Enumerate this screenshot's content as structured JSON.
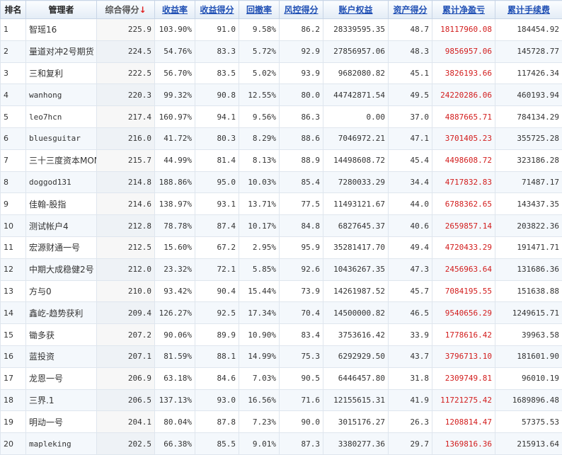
{
  "table": {
    "headers": {
      "rank": "排名",
      "manager": "管理者",
      "composite_score": "综合得分",
      "return_rate": "收益率",
      "return_score": "收益得分",
      "drawdown": "回撤率",
      "risk_score": "风控得分",
      "equity": "账户权益",
      "asset_score": "资产得分",
      "cum_pnl": "累计净盈亏",
      "cum_fee": "累计手续费",
      "sort_arrow": "↓"
    },
    "rows": [
      {
        "rank": "1",
        "manager": "智瑶16",
        "composite": "225.9",
        "return_rate": "103.90%",
        "return_score": "91.0",
        "drawdown": "9.58%",
        "risk_score": "86.2",
        "equity": "28339595.35",
        "asset_score": "48.7",
        "cum_pnl": "18117960.08",
        "cum_fee": "184454.92"
      },
      {
        "rank": "2",
        "manager": "量道对冲2号期货",
        "composite": "224.5",
        "return_rate": "54.76%",
        "return_score": "83.3",
        "drawdown": "5.72%",
        "risk_score": "92.9",
        "equity": "27856957.06",
        "asset_score": "48.3",
        "cum_pnl": "9856957.06",
        "cum_fee": "145728.77"
      },
      {
        "rank": "3",
        "manager": "三和复利",
        "composite": "222.5",
        "return_rate": "56.70%",
        "return_score": "83.5",
        "drawdown": "5.02%",
        "risk_score": "93.9",
        "equity": "9682080.82",
        "asset_score": "45.1",
        "cum_pnl": "3826193.66",
        "cum_fee": "117426.34"
      },
      {
        "rank": "4",
        "manager": "wanhong",
        "composite": "220.3",
        "return_rate": "99.32%",
        "return_score": "90.8",
        "drawdown": "12.55%",
        "risk_score": "80.0",
        "equity": "44742871.54",
        "asset_score": "49.5",
        "cum_pnl": "24220286.06",
        "cum_fee": "460193.94"
      },
      {
        "rank": "5",
        "manager": "leo7hcn",
        "composite": "217.4",
        "return_rate": "160.97%",
        "return_score": "94.1",
        "drawdown": "9.56%",
        "risk_score": "86.3",
        "equity": "0.00",
        "asset_score": "37.0",
        "cum_pnl": "4887665.71",
        "cum_fee": "784134.29"
      },
      {
        "rank": "6",
        "manager": "bluesguitar",
        "composite": "216.0",
        "return_rate": "41.72%",
        "return_score": "80.3",
        "drawdown": "8.29%",
        "risk_score": "88.6",
        "equity": "7046972.21",
        "asset_score": "47.1",
        "cum_pnl": "3701405.23",
        "cum_fee": "355725.28"
      },
      {
        "rank": "7",
        "manager": "三十三度资本MOM",
        "composite": "215.7",
        "return_rate": "44.99%",
        "return_score": "81.4",
        "drawdown": "8.13%",
        "risk_score": "88.9",
        "equity": "14498608.72",
        "asset_score": "45.4",
        "cum_pnl": "4498608.72",
        "cum_fee": "323186.28"
      },
      {
        "rank": "8",
        "manager": "doggod131",
        "composite": "214.8",
        "return_rate": "188.86%",
        "return_score": "95.0",
        "drawdown": "10.03%",
        "risk_score": "85.4",
        "equity": "7280033.29",
        "asset_score": "34.4",
        "cum_pnl": "4717832.83",
        "cum_fee": "71487.17"
      },
      {
        "rank": "9",
        "manager": "佳翰-股指",
        "composite": "214.6",
        "return_rate": "138.97%",
        "return_score": "93.1",
        "drawdown": "13.71%",
        "risk_score": "77.5",
        "equity": "11493121.67",
        "asset_score": "44.0",
        "cum_pnl": "6788362.65",
        "cum_fee": "143437.35"
      },
      {
        "rank": "10",
        "manager": "测试帐户4",
        "composite": "212.8",
        "return_rate": "78.78%",
        "return_score": "87.4",
        "drawdown": "10.17%",
        "risk_score": "84.8",
        "equity": "6827645.37",
        "asset_score": "40.6",
        "cum_pnl": "2659857.14",
        "cum_fee": "203822.36"
      },
      {
        "rank": "11",
        "manager": "宏源财通一号",
        "composite": "212.5",
        "return_rate": "15.60%",
        "return_score": "67.2",
        "drawdown": "2.95%",
        "risk_score": "95.9",
        "equity": "35281417.70",
        "asset_score": "49.4",
        "cum_pnl": "4720433.29",
        "cum_fee": "191471.71"
      },
      {
        "rank": "12",
        "manager": "中期大成稳健2号",
        "composite": "212.0",
        "return_rate": "23.32%",
        "return_score": "72.1",
        "drawdown": "5.85%",
        "risk_score": "92.6",
        "equity": "10436267.35",
        "asset_score": "47.3",
        "cum_pnl": "2456963.64",
        "cum_fee": "131686.36"
      },
      {
        "rank": "13",
        "manager": "方与0",
        "composite": "210.0",
        "return_rate": "93.42%",
        "return_score": "90.4",
        "drawdown": "15.44%",
        "risk_score": "73.9",
        "equity": "14261987.52",
        "asset_score": "45.7",
        "cum_pnl": "7084195.55",
        "cum_fee": "151638.88"
      },
      {
        "rank": "14",
        "manager": "鑫屹-趋势获利",
        "composite": "209.4",
        "return_rate": "126.27%",
        "return_score": "92.5",
        "drawdown": "17.34%",
        "risk_score": "70.4",
        "equity": "14500000.82",
        "asset_score": "46.5",
        "cum_pnl": "9540656.29",
        "cum_fee": "1249615.71"
      },
      {
        "rank": "15",
        "manager": "锄多获",
        "composite": "207.2",
        "return_rate": "90.06%",
        "return_score": "89.9",
        "drawdown": "10.90%",
        "risk_score": "83.4",
        "equity": "3753616.42",
        "asset_score": "33.9",
        "cum_pnl": "1778616.42",
        "cum_fee": "39963.58"
      },
      {
        "rank": "16",
        "manager": "蓝投资",
        "composite": "207.1",
        "return_rate": "81.59%",
        "return_score": "88.1",
        "drawdown": "14.99%",
        "risk_score": "75.3",
        "equity": "6292929.50",
        "asset_score": "43.7",
        "cum_pnl": "3796713.10",
        "cum_fee": "181601.90"
      },
      {
        "rank": "17",
        "manager": "龙恩一号",
        "composite": "206.9",
        "return_rate": "63.18%",
        "return_score": "84.6",
        "drawdown": "7.03%",
        "risk_score": "90.5",
        "equity": "6446457.80",
        "asset_score": "31.8",
        "cum_pnl": "2309749.81",
        "cum_fee": "96010.19"
      },
      {
        "rank": "18",
        "manager": "三界.1",
        "composite": "206.5",
        "return_rate": "137.13%",
        "return_score": "93.0",
        "drawdown": "16.56%",
        "risk_score": "71.6",
        "equity": "12155615.31",
        "asset_score": "41.9",
        "cum_pnl": "11721275.42",
        "cum_fee": "1689896.48"
      },
      {
        "rank": "19",
        "manager": "明动一号",
        "composite": "204.1",
        "return_rate": "80.04%",
        "return_score": "87.8",
        "drawdown": "7.23%",
        "risk_score": "90.0",
        "equity": "3015176.27",
        "asset_score": "26.3",
        "cum_pnl": "1208814.47",
        "cum_fee": "57375.53"
      },
      {
        "rank": "20",
        "manager": "mapleking",
        "composite": "202.5",
        "return_rate": "66.38%",
        "return_score": "85.5",
        "drawdown": "9.01%",
        "risk_score": "87.3",
        "equity": "3380277.36",
        "asset_score": "29.7",
        "cum_pnl": "1369816.36",
        "cum_fee": "215913.64"
      }
    ]
  },
  "colors": {
    "header_link": "#1f4fb4",
    "pnl_red": "#d21d1d",
    "sort_arrow": "#e02020",
    "grid": "#dfe6ee"
  }
}
